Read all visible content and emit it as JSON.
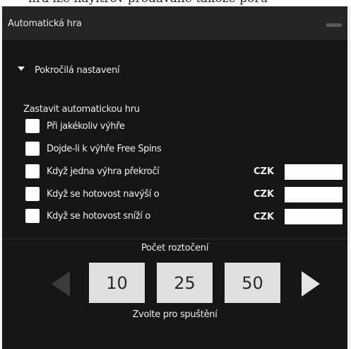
{
  "background_text": "nra lze nayitrov prodavane takoze poru",
  "window": {
    "title": "Automatická hra",
    "minimize_icon": "minus-icon"
  },
  "advanced": {
    "label": "Pokročilá nastavení",
    "expanded": true,
    "toggle_icon": "triangle-down-icon"
  },
  "stop": {
    "title": "Zastavit automatickou hru",
    "conditions": [
      {
        "label": "Při jakékoliv výhře",
        "checked": false
      },
      {
        "label": "Dojde-li k výhře Free Spins",
        "checked": false
      },
      {
        "label": "Když jedna výhra překročí",
        "checked": false,
        "currency": "CZK",
        "value": ""
      },
      {
        "label": "Když se hotovost navýší o",
        "checked": false,
        "currency": "CZK",
        "value": ""
      },
      {
        "label": "Když se hotovost sníží o",
        "checked": false,
        "currency": "CZK",
        "value": ""
      }
    ]
  },
  "spins": {
    "title": "Počet roztočení",
    "options": [
      "10",
      "25",
      "50"
    ],
    "prev_icon": "arrow-left-icon",
    "next_icon": "arrow-right-icon",
    "hint": "Zvolte pro spuštění"
  },
  "colors": {
    "panel_bg": "#151515",
    "header_bg": "#242424",
    "button_bg": "#e0e0e0",
    "arrow_disabled": "#3c3c3c",
    "arrow_enabled": "#e6e6e6"
  }
}
